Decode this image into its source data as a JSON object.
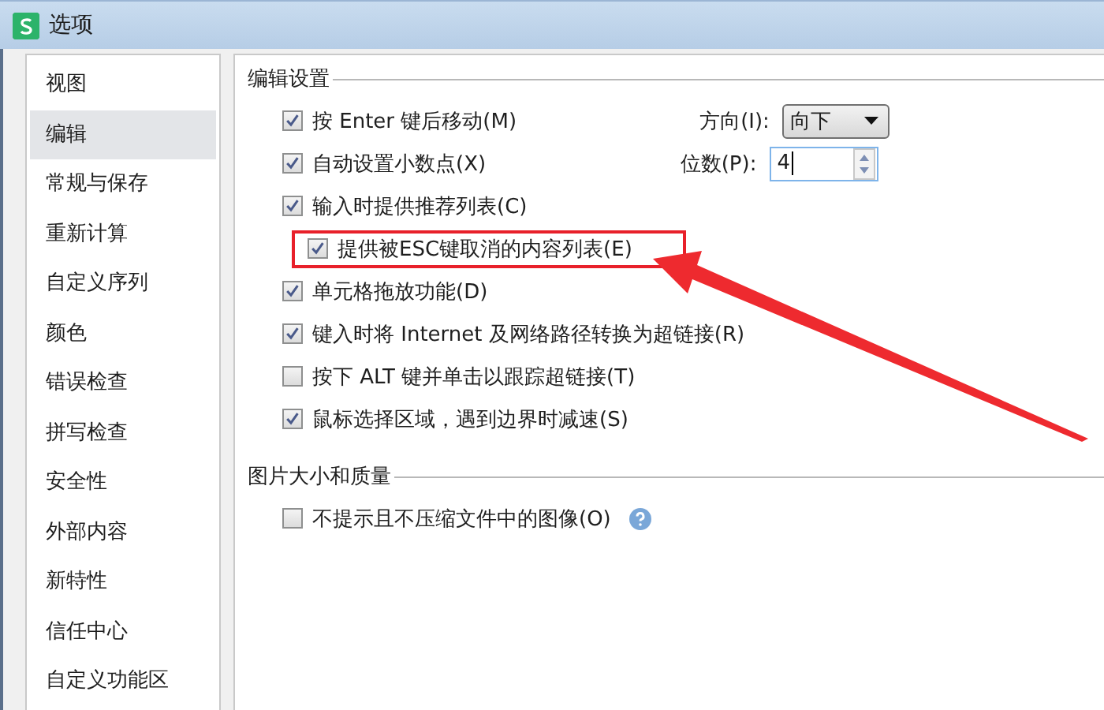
{
  "window": {
    "title": "选项"
  },
  "sidebar": {
    "items": [
      {
        "label": "视图",
        "selected": false
      },
      {
        "label": "编辑",
        "selected": true
      },
      {
        "label": "常规与保存",
        "selected": false
      },
      {
        "label": "重新计算",
        "selected": false
      },
      {
        "label": "自定义序列",
        "selected": false
      },
      {
        "label": "颜色",
        "selected": false
      },
      {
        "label": "错误检查",
        "selected": false
      },
      {
        "label": "拼写检查",
        "selected": false
      },
      {
        "label": "安全性",
        "selected": false
      },
      {
        "label": "外部内容",
        "selected": false
      },
      {
        "label": "新特性",
        "selected": false
      },
      {
        "label": "信任中心",
        "selected": false
      },
      {
        "label": "自定义功能区",
        "selected": false
      }
    ]
  },
  "sections": [
    {
      "title": "编辑设置",
      "options": [
        {
          "label": "按 Enter 键后移动(M)",
          "checked": true,
          "extra": {
            "kind": "dropdown",
            "label": "方向(I):",
            "value": "向下"
          }
        },
        {
          "label": "自动设置小数点(X)",
          "checked": true,
          "extra": {
            "kind": "spin",
            "label": "位数(P):",
            "value": "4"
          }
        },
        {
          "label": "输入时提供推荐列表(C)",
          "checked": true,
          "children": [
            {
              "label": "提供被ESC键取消的内容列表(E)",
              "checked": true,
              "highlighted": true
            }
          ]
        },
        {
          "label": "单元格拖放功能(D)",
          "checked": true
        },
        {
          "label": "键入时将 Internet 及网络路径转换为超链接(R)",
          "checked": true
        },
        {
          "label": "按下 ALT 键并单击以跟踪超链接(T)",
          "checked": false
        },
        {
          "label": "鼠标选择区域，遇到边界时减速(S)",
          "checked": true
        }
      ]
    },
    {
      "title": "图片大小和质量",
      "options": [
        {
          "label": "不提示且不压缩文件中的图像(O)",
          "checked": false,
          "help": true
        }
      ]
    }
  ]
}
